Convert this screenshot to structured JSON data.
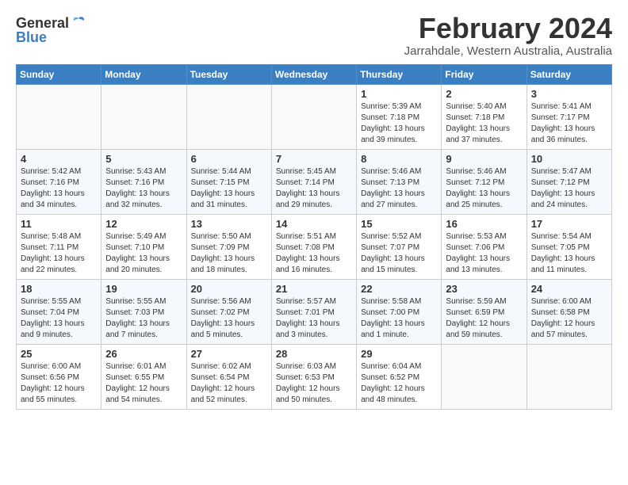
{
  "logo": {
    "general": "General",
    "blue": "Blue"
  },
  "title": "February 2024",
  "location": "Jarrahdale, Western Australia, Australia",
  "days_of_week": [
    "Sunday",
    "Monday",
    "Tuesday",
    "Wednesday",
    "Thursday",
    "Friday",
    "Saturday"
  ],
  "weeks": [
    [
      {
        "day": "",
        "info": ""
      },
      {
        "day": "",
        "info": ""
      },
      {
        "day": "",
        "info": ""
      },
      {
        "day": "",
        "info": ""
      },
      {
        "day": "1",
        "info": "Sunrise: 5:39 AM\nSunset: 7:18 PM\nDaylight: 13 hours\nand 39 minutes."
      },
      {
        "day": "2",
        "info": "Sunrise: 5:40 AM\nSunset: 7:18 PM\nDaylight: 13 hours\nand 37 minutes."
      },
      {
        "day": "3",
        "info": "Sunrise: 5:41 AM\nSunset: 7:17 PM\nDaylight: 13 hours\nand 36 minutes."
      }
    ],
    [
      {
        "day": "4",
        "info": "Sunrise: 5:42 AM\nSunset: 7:16 PM\nDaylight: 13 hours\nand 34 minutes."
      },
      {
        "day": "5",
        "info": "Sunrise: 5:43 AM\nSunset: 7:16 PM\nDaylight: 13 hours\nand 32 minutes."
      },
      {
        "day": "6",
        "info": "Sunrise: 5:44 AM\nSunset: 7:15 PM\nDaylight: 13 hours\nand 31 minutes."
      },
      {
        "day": "7",
        "info": "Sunrise: 5:45 AM\nSunset: 7:14 PM\nDaylight: 13 hours\nand 29 minutes."
      },
      {
        "day": "8",
        "info": "Sunrise: 5:46 AM\nSunset: 7:13 PM\nDaylight: 13 hours\nand 27 minutes."
      },
      {
        "day": "9",
        "info": "Sunrise: 5:46 AM\nSunset: 7:12 PM\nDaylight: 13 hours\nand 25 minutes."
      },
      {
        "day": "10",
        "info": "Sunrise: 5:47 AM\nSunset: 7:12 PM\nDaylight: 13 hours\nand 24 minutes."
      }
    ],
    [
      {
        "day": "11",
        "info": "Sunrise: 5:48 AM\nSunset: 7:11 PM\nDaylight: 13 hours\nand 22 minutes."
      },
      {
        "day": "12",
        "info": "Sunrise: 5:49 AM\nSunset: 7:10 PM\nDaylight: 13 hours\nand 20 minutes."
      },
      {
        "day": "13",
        "info": "Sunrise: 5:50 AM\nSunset: 7:09 PM\nDaylight: 13 hours\nand 18 minutes."
      },
      {
        "day": "14",
        "info": "Sunrise: 5:51 AM\nSunset: 7:08 PM\nDaylight: 13 hours\nand 16 minutes."
      },
      {
        "day": "15",
        "info": "Sunrise: 5:52 AM\nSunset: 7:07 PM\nDaylight: 13 hours\nand 15 minutes."
      },
      {
        "day": "16",
        "info": "Sunrise: 5:53 AM\nSunset: 7:06 PM\nDaylight: 13 hours\nand 13 minutes."
      },
      {
        "day": "17",
        "info": "Sunrise: 5:54 AM\nSunset: 7:05 PM\nDaylight: 13 hours\nand 11 minutes."
      }
    ],
    [
      {
        "day": "18",
        "info": "Sunrise: 5:55 AM\nSunset: 7:04 PM\nDaylight: 13 hours\nand 9 minutes."
      },
      {
        "day": "19",
        "info": "Sunrise: 5:55 AM\nSunset: 7:03 PM\nDaylight: 13 hours\nand 7 minutes."
      },
      {
        "day": "20",
        "info": "Sunrise: 5:56 AM\nSunset: 7:02 PM\nDaylight: 13 hours\nand 5 minutes."
      },
      {
        "day": "21",
        "info": "Sunrise: 5:57 AM\nSunset: 7:01 PM\nDaylight: 13 hours\nand 3 minutes."
      },
      {
        "day": "22",
        "info": "Sunrise: 5:58 AM\nSunset: 7:00 PM\nDaylight: 13 hours\nand 1 minute."
      },
      {
        "day": "23",
        "info": "Sunrise: 5:59 AM\nSunset: 6:59 PM\nDaylight: 12 hours\nand 59 minutes."
      },
      {
        "day": "24",
        "info": "Sunrise: 6:00 AM\nSunset: 6:58 PM\nDaylight: 12 hours\nand 57 minutes."
      }
    ],
    [
      {
        "day": "25",
        "info": "Sunrise: 6:00 AM\nSunset: 6:56 PM\nDaylight: 12 hours\nand 55 minutes."
      },
      {
        "day": "26",
        "info": "Sunrise: 6:01 AM\nSunset: 6:55 PM\nDaylight: 12 hours\nand 54 minutes."
      },
      {
        "day": "27",
        "info": "Sunrise: 6:02 AM\nSunset: 6:54 PM\nDaylight: 12 hours\nand 52 minutes."
      },
      {
        "day": "28",
        "info": "Sunrise: 6:03 AM\nSunset: 6:53 PM\nDaylight: 12 hours\nand 50 minutes."
      },
      {
        "day": "29",
        "info": "Sunrise: 6:04 AM\nSunset: 6:52 PM\nDaylight: 12 hours\nand 48 minutes."
      },
      {
        "day": "",
        "info": ""
      },
      {
        "day": "",
        "info": ""
      }
    ]
  ]
}
